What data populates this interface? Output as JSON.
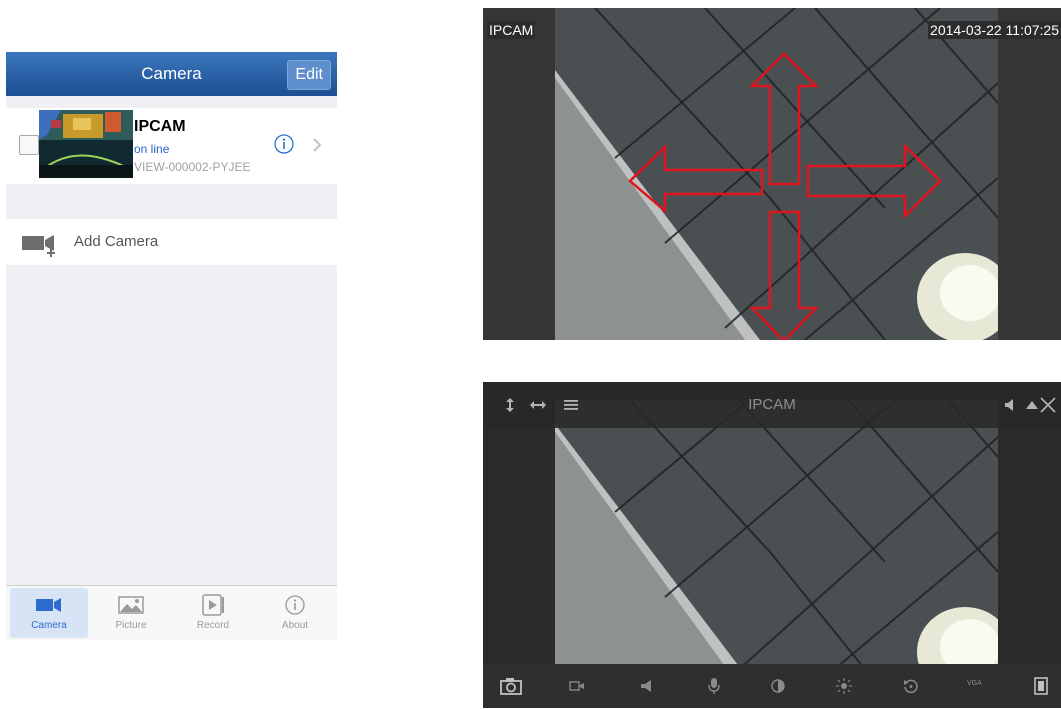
{
  "phone": {
    "title": "Camera",
    "edit_label": "Edit",
    "camera": {
      "name": "IPCAM",
      "status": "on line",
      "id": "VIEW-000002-PYJEE"
    },
    "add_camera_label": "Add Camera",
    "tabs": [
      {
        "label": "Camera",
        "icon": "video-camera-icon",
        "active": true
      },
      {
        "label": "Picture",
        "icon": "picture-icon",
        "active": false
      },
      {
        "label": "Record",
        "icon": "record-icon",
        "active": false
      },
      {
        "label": "About",
        "icon": "info-icon",
        "active": false
      }
    ],
    "colors": {
      "navbar": "#2a5fa5",
      "accent": "#2c6ccd"
    }
  },
  "viewer_overlay": {
    "camera_name": "IPCAM",
    "timestamp": "2014-03-22 11:07:25",
    "ptz_arrows": [
      "up",
      "down",
      "left",
      "right"
    ],
    "arrow_color": "#e0141e"
  },
  "viewer_controls": {
    "title": "IPCAM",
    "top_left_icons": [
      "vertical-flip-icon",
      "horizontal-flip-icon",
      "menu-icon"
    ],
    "top_right_icons": [
      "speaker-icon",
      "triangle-up-icon",
      "close-icon"
    ],
    "bottom_icons": [
      "snapshot-camera-icon",
      "record-video-icon",
      "speaker-icon",
      "microphone-icon",
      "contrast-icon",
      "brightness-icon",
      "reset-icon",
      "resolution-icon",
      "fullscreen-icon"
    ],
    "resolution_label": "VGA"
  }
}
